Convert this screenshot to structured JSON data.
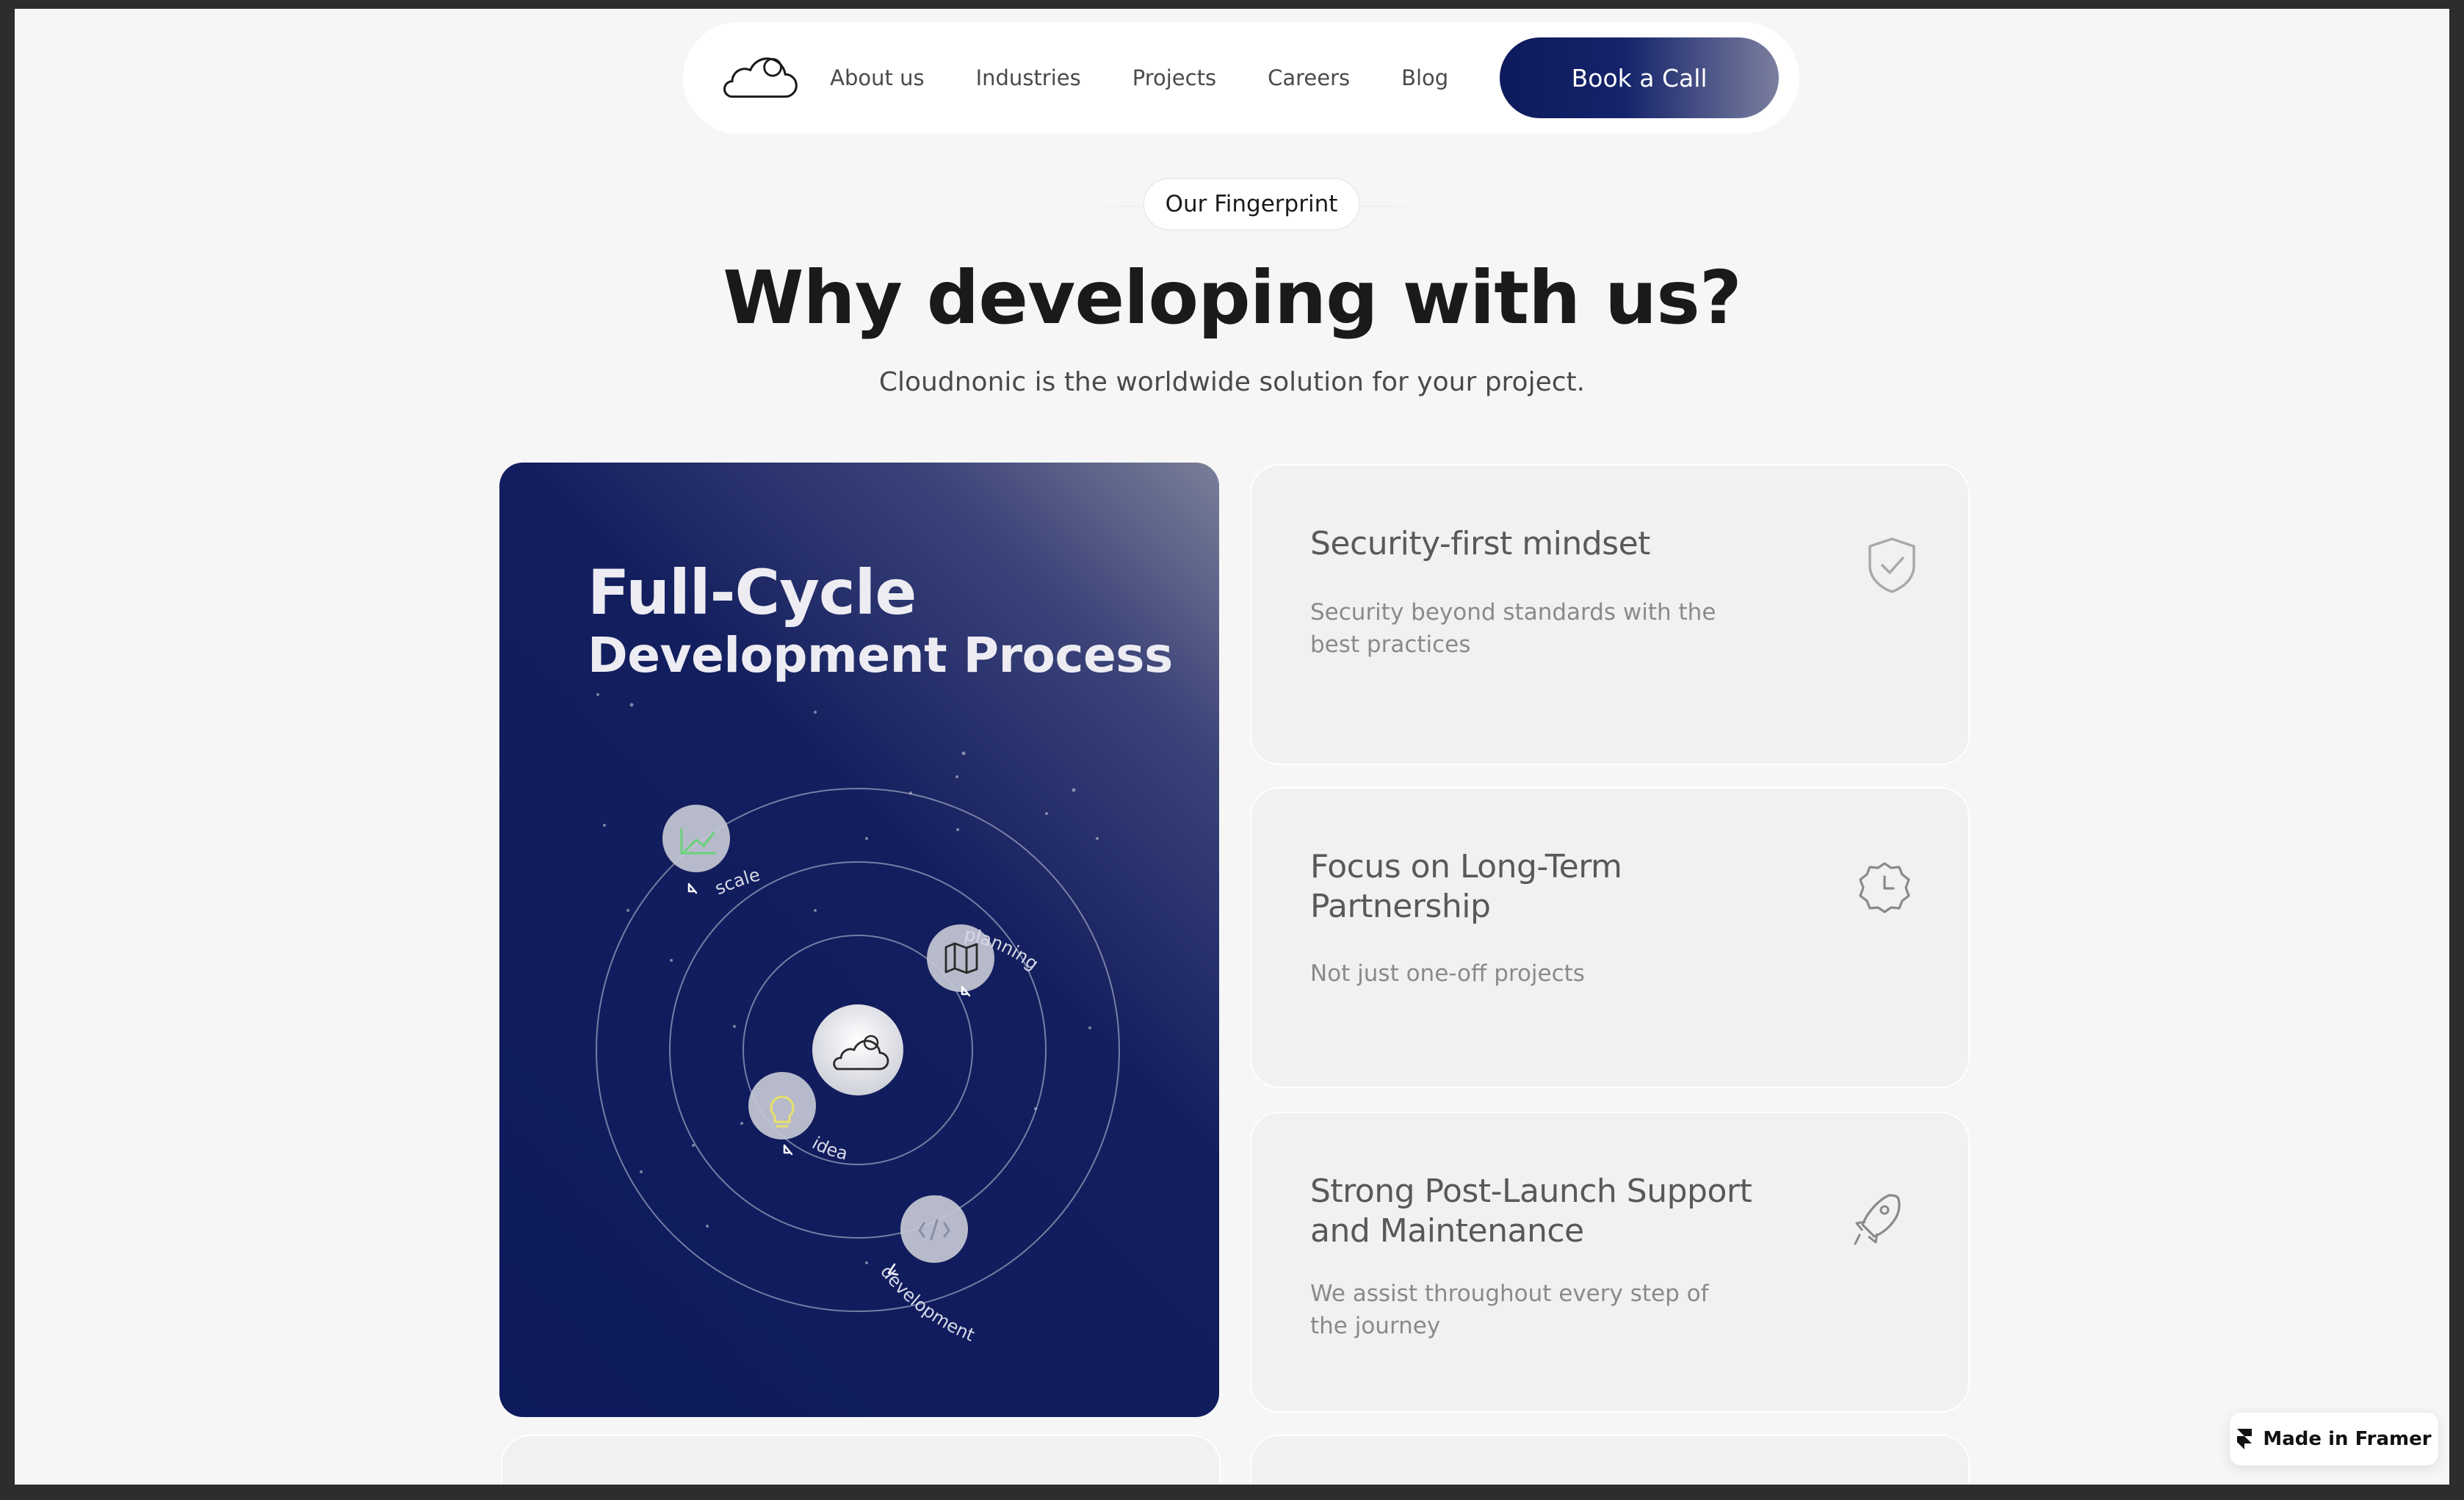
{
  "nav": {
    "links": [
      "About us",
      "Industries",
      "Projects",
      "Careers",
      "Blog"
    ],
    "cta_label": "Book a Call",
    "logo_icon": "cloud-logo-icon"
  },
  "header": {
    "eyebrow": "Our Fingerprint",
    "title": "Why developing with us?",
    "subtitle": "Cloudnonic is the worldwide solution for your project."
  },
  "hero": {
    "title": "Full-Cycle",
    "subtitle": "Development Process",
    "center_icon": "cloud-icon",
    "steps": [
      {
        "label": "scale",
        "icon": "growth-chart-icon"
      },
      {
        "label": "planning",
        "icon": "map-icon"
      },
      {
        "label": "idea",
        "icon": "lightbulb-icon"
      },
      {
        "label": "development",
        "icon": "code-icon"
      }
    ]
  },
  "features": [
    {
      "title": "Security-first mindset",
      "desc": "Security beyond standards with the best practices",
      "icon": "shield-check-icon"
    },
    {
      "title": "Focus on Long-Term Partnership",
      "desc": "Not just one-off projects",
      "icon": "badge-clock-icon"
    },
    {
      "title": "Strong Post-Launch Support and Maintenance",
      "desc": "We assist throughout every step of the journey",
      "icon": "rocket-icon"
    }
  ],
  "badge": {
    "label": "Made in Framer",
    "icon": "framer-icon"
  },
  "colors": {
    "navy": "#0d1a5c",
    "page_bg": "#f6f6f6",
    "card_bg": "#f1f1f1",
    "scale_accent": "#6ad27a",
    "idea_accent": "#e8e06a"
  }
}
